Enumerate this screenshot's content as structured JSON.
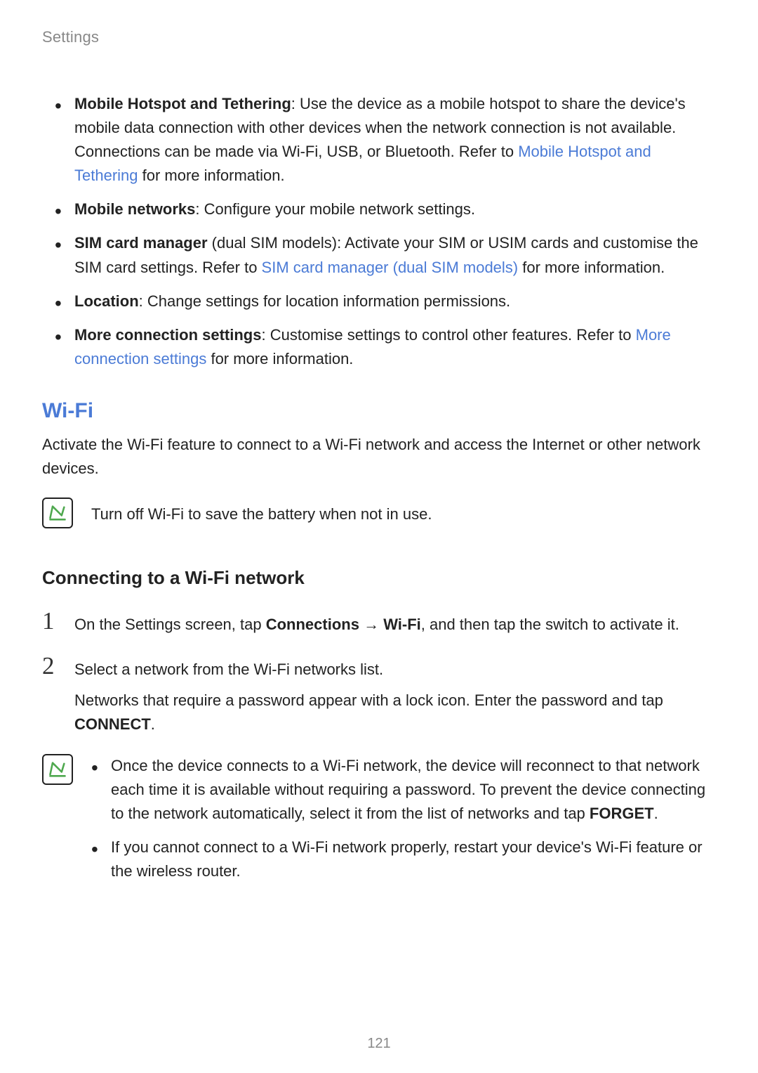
{
  "header": {
    "title": "Settings"
  },
  "bullets": {
    "hotspot": {
      "title": "Mobile Hotspot and Tethering",
      "text1": ": Use the device as a mobile hotspot to share the device's mobile data connection with other devices when the network connection is not available. Connections can be made via Wi-Fi, USB, or Bluetooth. Refer to ",
      "link": "Mobile Hotspot and Tethering",
      "text2": " for more information."
    },
    "mobile_networks": {
      "title": "Mobile networks",
      "text": ": Configure your mobile network settings."
    },
    "sim": {
      "title": "SIM card manager",
      "text1": " (dual SIM models): Activate your SIM or USIM cards and customise the SIM card settings. Refer to ",
      "link": "SIM card manager (dual SIM models)",
      "text2": " for more information."
    },
    "location": {
      "title": "Location",
      "text": ": Change settings for location information permissions."
    },
    "more": {
      "title": "More connection settings",
      "text1": ": Customise settings to control other features. Refer to ",
      "link": "More connection settings",
      "text2": " for more information."
    }
  },
  "wifi": {
    "heading": "Wi-Fi",
    "intro": "Activate the Wi-Fi feature to connect to a Wi-Fi network and access the Internet or other network devices.",
    "note": "Turn off Wi-Fi to save the battery when not in use."
  },
  "connecting": {
    "heading": "Connecting to a Wi-Fi network",
    "step1": {
      "num": "1",
      "pre": "On the Settings screen, tap ",
      "bold1": "Connections",
      "arrow": " → ",
      "bold2": "Wi-Fi",
      "post": ", and then tap the switch to activate it."
    },
    "step2": {
      "num": "2",
      "line1": "Select a network from the Wi-Fi networks list.",
      "line2_pre": "Networks that require a password appear with a lock icon. Enter the password and tap ",
      "line2_bold": "CONNECT",
      "line2_post": "."
    },
    "note_bullets": {
      "b1_pre": "Once the device connects to a Wi-Fi network, the device will reconnect to that network each time it is available without requiring a password. To prevent the device connecting to the network automatically, select it from the list of networks and tap ",
      "b1_bold": "FORGET",
      "b1_post": ".",
      "b2": "If you cannot connect to a Wi-Fi network properly, restart your device's Wi-Fi feature or the wireless router."
    }
  },
  "page_number": "121"
}
